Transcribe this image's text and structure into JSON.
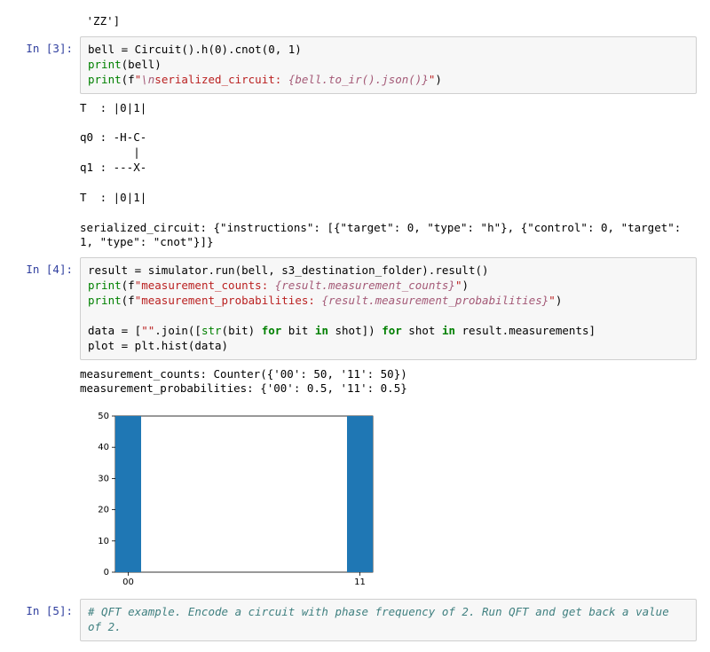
{
  "cell0": {
    "fragment": " 'ZZ']"
  },
  "cell3": {
    "prompt": "In [3]:",
    "code": {
      "line1": "bell = Circuit().h(0).cnot(0, 1)",
      "line2a": "print",
      "line2b": "(bell)",
      "line3a": "print",
      "line3b": "(f",
      "line3c": "\"",
      "line3d": "\\n",
      "line3e": "serialized_circuit: ",
      "line3f": "{bell.to_ir().json()}",
      "line3g": "\"",
      "line3h": ")"
    },
    "output": "T  : |0|1|\n          \nq0 : -H-C-\n        | \nq1 : ---X-\n\nT  : |0|1|\n\nserialized_circuit: {\"instructions\": [{\"target\": 0, \"type\": \"h\"}, {\"control\": 0, \"target\": 1, \"type\": \"cnot\"}]}"
  },
  "cell4": {
    "prompt": "In [4]:",
    "code": {
      "l1": "result = simulator.run(bell, s3_destination_folder).result()",
      "l2a": "print",
      "l2b": "(f",
      "l2c": "\"measurement_counts: ",
      "l2d": "{result.measurement_counts}",
      "l2e": "\"",
      "l2f": ")",
      "l3a": "print",
      "l3b": "(f",
      "l3c": "\"measurement_probabilities: ",
      "l3d": "{result.measurement_probabilities}",
      "l3e": "\"",
      "l3f": ")",
      "l4": "",
      "l5a": "data = [",
      "l5b": "\"\"",
      "l5c": ".join([",
      "l5d": "str",
      "l5e": "(bit) ",
      "l5f": "for",
      "l5g": " bit ",
      "l5h": "in",
      "l5i": " shot]) ",
      "l5j": "for",
      "l5k": " shot ",
      "l5l": "in",
      "l5m": " result.measurements]",
      "l6": "plot = plt.hist(data)"
    },
    "output_text": "measurement_counts: Counter({'00': 50, '11': 50})\nmeasurement_probabilities: {'00': 0.5, '11': 0.5}"
  },
  "cell5": {
    "prompt": "In [5]:",
    "comment": "# QFT example. Encode a circuit with phase frequency of 2. Run QFT and get back a value of 2."
  },
  "chart_data": {
    "type": "bar",
    "categories": [
      "00",
      "11"
    ],
    "values": [
      50,
      50
    ],
    "ylim": [
      0,
      50
    ],
    "yticks": [
      0,
      10,
      20,
      30,
      40,
      50
    ],
    "xtick_labels": [
      "00",
      "11"
    ]
  }
}
